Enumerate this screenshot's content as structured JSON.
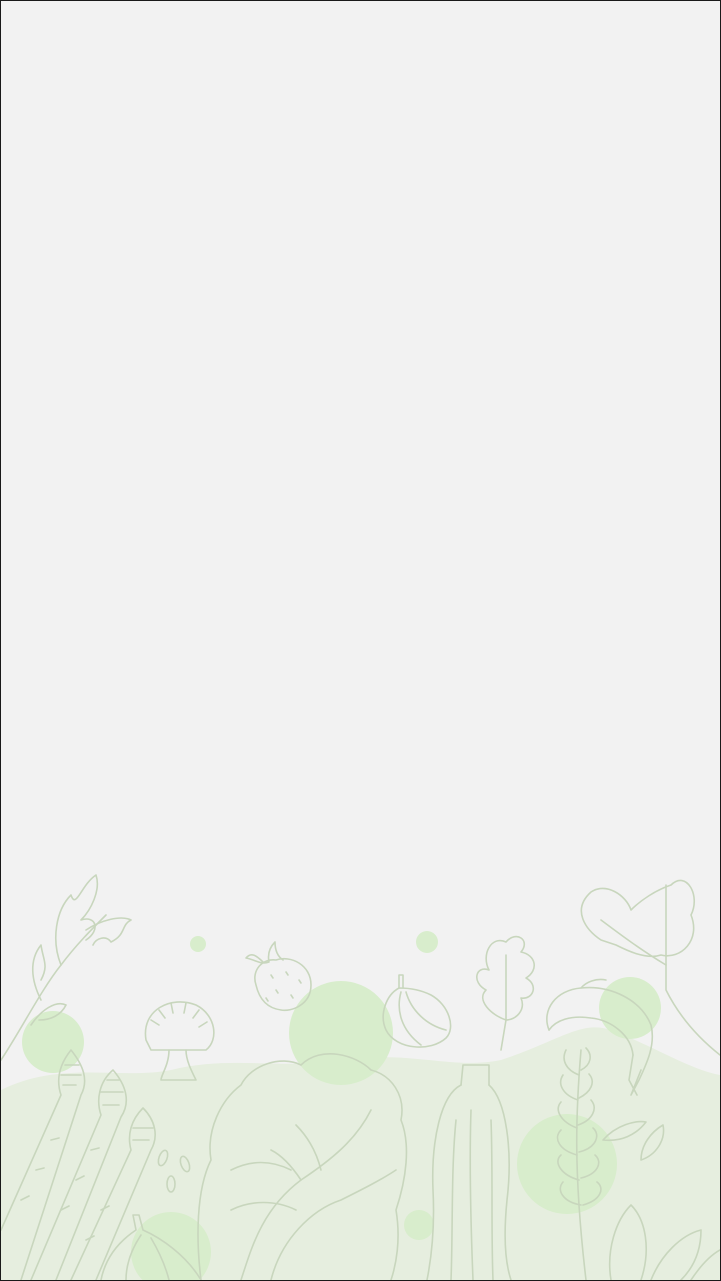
{
  "screen": {
    "background_color": "#f2f2f2",
    "frame_color": "#1a1a1a"
  },
  "decoration": {
    "icon_name": "vegetable-line-art-illustration",
    "line_color": "#c8d6bd",
    "blob_color": "#d8edcc",
    "hill_color": "#e6eedf"
  }
}
